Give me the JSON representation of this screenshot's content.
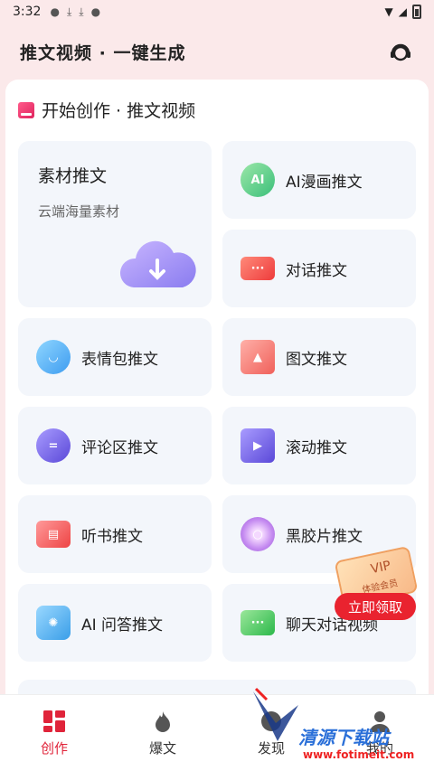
{
  "status": {
    "time": "3:32"
  },
  "appbar": {
    "title": "推文视频 · 一键生成"
  },
  "section": {
    "title": "开始创作 · 推文视频"
  },
  "big_card": {
    "title": "素材推文",
    "subtitle": "云端海量素材"
  },
  "cards": [
    {
      "label": "AI漫画推文",
      "icon": "ai-comic-icon",
      "icon_text": "AI"
    },
    {
      "label": "对话推文",
      "icon": "dialog-icon"
    },
    {
      "label": "表情包推文",
      "icon": "emoji-icon"
    },
    {
      "label": "图文推文",
      "icon": "image-icon"
    },
    {
      "label": "评论区推文",
      "icon": "comment-icon"
    },
    {
      "label": "滚动推文",
      "icon": "scroll-video-icon"
    },
    {
      "label": "听书推文",
      "icon": "book-icon"
    },
    {
      "label": "黑胶片推文",
      "icon": "vinyl-icon"
    },
    {
      "label": "AI 问答推文",
      "icon": "ai-qa-icon"
    },
    {
      "label": "聊天对话视频",
      "icon": "chat-icon"
    }
  ],
  "promo": {
    "vip": "VIP",
    "vip_sub": "体验会员",
    "claim": "立即领取"
  },
  "tabs": [
    {
      "label": "创作",
      "icon": "create-grid-icon",
      "active": true
    },
    {
      "label": "爆文",
      "icon": "flame-icon"
    },
    {
      "label": "发现",
      "icon": "discover-icon"
    },
    {
      "label": "我的",
      "icon": "profile-icon"
    }
  ],
  "watermark": {
    "text": "清源下载站",
    "url": "www.fotimeit.com"
  },
  "colors": {
    "accent": "#e0243a",
    "card_bg": "#f3f6fb",
    "header_bg": "#fbe9ea"
  }
}
